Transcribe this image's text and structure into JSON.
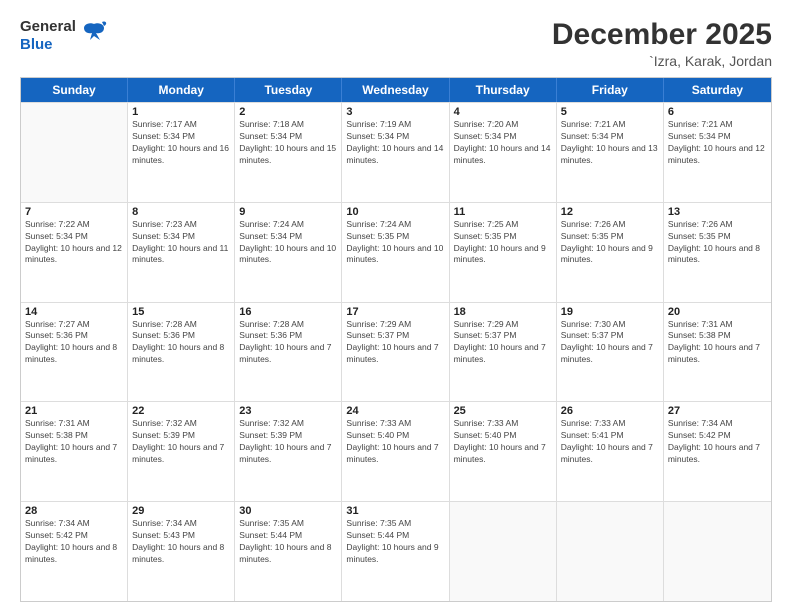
{
  "header": {
    "logo_general": "General",
    "logo_blue": "Blue",
    "month_title": "December 2025",
    "location": "`Izra, Karak, Jordan"
  },
  "days": [
    "Sunday",
    "Monday",
    "Tuesday",
    "Wednesday",
    "Thursday",
    "Friday",
    "Saturday"
  ],
  "weeks": [
    [
      {
        "date": "",
        "sunrise": "",
        "sunset": "",
        "daylight": ""
      },
      {
        "date": "1",
        "sunrise": "Sunrise: 7:17 AM",
        "sunset": "Sunset: 5:34 PM",
        "daylight": "Daylight: 10 hours and 16 minutes."
      },
      {
        "date": "2",
        "sunrise": "Sunrise: 7:18 AM",
        "sunset": "Sunset: 5:34 PM",
        "daylight": "Daylight: 10 hours and 15 minutes."
      },
      {
        "date": "3",
        "sunrise": "Sunrise: 7:19 AM",
        "sunset": "Sunset: 5:34 PM",
        "daylight": "Daylight: 10 hours and 14 minutes."
      },
      {
        "date": "4",
        "sunrise": "Sunrise: 7:20 AM",
        "sunset": "Sunset: 5:34 PM",
        "daylight": "Daylight: 10 hours and 14 minutes."
      },
      {
        "date": "5",
        "sunrise": "Sunrise: 7:21 AM",
        "sunset": "Sunset: 5:34 PM",
        "daylight": "Daylight: 10 hours and 13 minutes."
      },
      {
        "date": "6",
        "sunrise": "Sunrise: 7:21 AM",
        "sunset": "Sunset: 5:34 PM",
        "daylight": "Daylight: 10 hours and 12 minutes."
      }
    ],
    [
      {
        "date": "7",
        "sunrise": "Sunrise: 7:22 AM",
        "sunset": "Sunset: 5:34 PM",
        "daylight": "Daylight: 10 hours and 12 minutes."
      },
      {
        "date": "8",
        "sunrise": "Sunrise: 7:23 AM",
        "sunset": "Sunset: 5:34 PM",
        "daylight": "Daylight: 10 hours and 11 minutes."
      },
      {
        "date": "9",
        "sunrise": "Sunrise: 7:24 AM",
        "sunset": "Sunset: 5:34 PM",
        "daylight": "Daylight: 10 hours and 10 minutes."
      },
      {
        "date": "10",
        "sunrise": "Sunrise: 7:24 AM",
        "sunset": "Sunset: 5:35 PM",
        "daylight": "Daylight: 10 hours and 10 minutes."
      },
      {
        "date": "11",
        "sunrise": "Sunrise: 7:25 AM",
        "sunset": "Sunset: 5:35 PM",
        "daylight": "Daylight: 10 hours and 9 minutes."
      },
      {
        "date": "12",
        "sunrise": "Sunrise: 7:26 AM",
        "sunset": "Sunset: 5:35 PM",
        "daylight": "Daylight: 10 hours and 9 minutes."
      },
      {
        "date": "13",
        "sunrise": "Sunrise: 7:26 AM",
        "sunset": "Sunset: 5:35 PM",
        "daylight": "Daylight: 10 hours and 8 minutes."
      }
    ],
    [
      {
        "date": "14",
        "sunrise": "Sunrise: 7:27 AM",
        "sunset": "Sunset: 5:36 PM",
        "daylight": "Daylight: 10 hours and 8 minutes."
      },
      {
        "date": "15",
        "sunrise": "Sunrise: 7:28 AM",
        "sunset": "Sunset: 5:36 PM",
        "daylight": "Daylight: 10 hours and 8 minutes."
      },
      {
        "date": "16",
        "sunrise": "Sunrise: 7:28 AM",
        "sunset": "Sunset: 5:36 PM",
        "daylight": "Daylight: 10 hours and 7 minutes."
      },
      {
        "date": "17",
        "sunrise": "Sunrise: 7:29 AM",
        "sunset": "Sunset: 5:37 PM",
        "daylight": "Daylight: 10 hours and 7 minutes."
      },
      {
        "date": "18",
        "sunrise": "Sunrise: 7:29 AM",
        "sunset": "Sunset: 5:37 PM",
        "daylight": "Daylight: 10 hours and 7 minutes."
      },
      {
        "date": "19",
        "sunrise": "Sunrise: 7:30 AM",
        "sunset": "Sunset: 5:37 PM",
        "daylight": "Daylight: 10 hours and 7 minutes."
      },
      {
        "date": "20",
        "sunrise": "Sunrise: 7:31 AM",
        "sunset": "Sunset: 5:38 PM",
        "daylight": "Daylight: 10 hours and 7 minutes."
      }
    ],
    [
      {
        "date": "21",
        "sunrise": "Sunrise: 7:31 AM",
        "sunset": "Sunset: 5:38 PM",
        "daylight": "Daylight: 10 hours and 7 minutes."
      },
      {
        "date": "22",
        "sunrise": "Sunrise: 7:32 AM",
        "sunset": "Sunset: 5:39 PM",
        "daylight": "Daylight: 10 hours and 7 minutes."
      },
      {
        "date": "23",
        "sunrise": "Sunrise: 7:32 AM",
        "sunset": "Sunset: 5:39 PM",
        "daylight": "Daylight: 10 hours and 7 minutes."
      },
      {
        "date": "24",
        "sunrise": "Sunrise: 7:33 AM",
        "sunset": "Sunset: 5:40 PM",
        "daylight": "Daylight: 10 hours and 7 minutes."
      },
      {
        "date": "25",
        "sunrise": "Sunrise: 7:33 AM",
        "sunset": "Sunset: 5:40 PM",
        "daylight": "Daylight: 10 hours and 7 minutes."
      },
      {
        "date": "26",
        "sunrise": "Sunrise: 7:33 AM",
        "sunset": "Sunset: 5:41 PM",
        "daylight": "Daylight: 10 hours and 7 minutes."
      },
      {
        "date": "27",
        "sunrise": "Sunrise: 7:34 AM",
        "sunset": "Sunset: 5:42 PM",
        "daylight": "Daylight: 10 hours and 7 minutes."
      }
    ],
    [
      {
        "date": "28",
        "sunrise": "Sunrise: 7:34 AM",
        "sunset": "Sunset: 5:42 PM",
        "daylight": "Daylight: 10 hours and 8 minutes."
      },
      {
        "date": "29",
        "sunrise": "Sunrise: 7:34 AM",
        "sunset": "Sunset: 5:43 PM",
        "daylight": "Daylight: 10 hours and 8 minutes."
      },
      {
        "date": "30",
        "sunrise": "Sunrise: 7:35 AM",
        "sunset": "Sunset: 5:44 PM",
        "daylight": "Daylight: 10 hours and 8 minutes."
      },
      {
        "date": "31",
        "sunrise": "Sunrise: 7:35 AM",
        "sunset": "Sunset: 5:44 PM",
        "daylight": "Daylight: 10 hours and 9 minutes."
      },
      {
        "date": "",
        "sunrise": "",
        "sunset": "",
        "daylight": ""
      },
      {
        "date": "",
        "sunrise": "",
        "sunset": "",
        "daylight": ""
      },
      {
        "date": "",
        "sunrise": "",
        "sunset": "",
        "daylight": ""
      }
    ]
  ]
}
